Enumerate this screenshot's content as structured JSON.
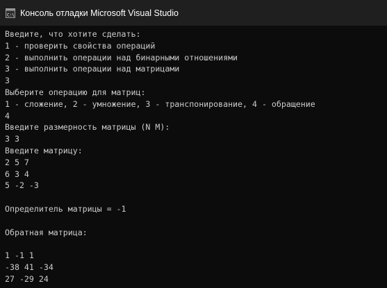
{
  "window": {
    "title": "Консоль отладки Microsoft Visual Studio",
    "icon": "console-app-icon",
    "background": "#0c0c0c",
    "titlebar_background": "#1f1f1f",
    "text_color": "#cccccc"
  },
  "console": {
    "lines": [
      "Введите, что хотите сделать:",
      "1 - проверить свойства операций",
      "2 - выполнить операции над бинарными отношениями",
      "3 - выполнить операции над матрицами",
      "3",
      "Выберите операцию для матриц:",
      "1 - сложение, 2 - умножение, 3 - транспонирование, 4 - обращение",
      "4",
      "Введите размерность матрицы (N M):",
      "3 3",
      "Введите матрицу:",
      "2 5 7",
      "6 3 4",
      "5 -2 -3",
      "",
      "Определитель матрицы = -1",
      "",
      "Обратная матрица:",
      "",
      "1 -1 1",
      "-38 41 -34",
      "27 -29 24"
    ]
  }
}
